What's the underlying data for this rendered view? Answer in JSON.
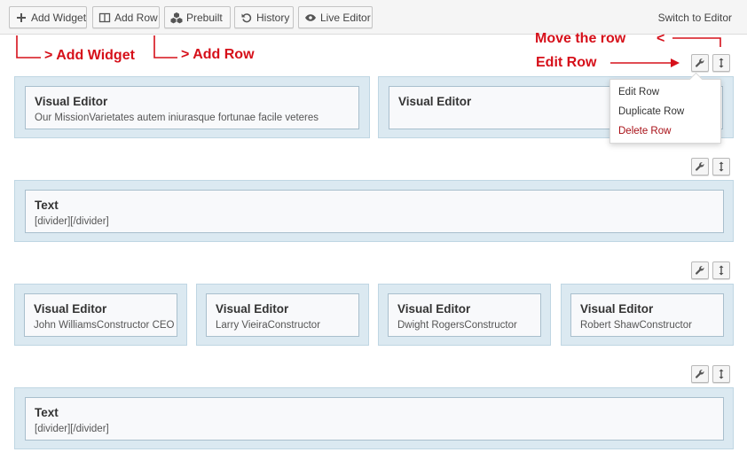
{
  "toolbar": {
    "add_widget": "Add Widget",
    "add_row": "Add Row",
    "prebuilt": "Prebuilt",
    "history": "History",
    "live_editor": "Live Editor",
    "switch_to_editor": "Switch to Editor"
  },
  "annotations": {
    "add_widget": "> Add Widget",
    "add_row": "> Add Row",
    "move_row": "Move the row",
    "move_arrow_head": "<",
    "edit_row": "Edit Row"
  },
  "rows": [
    {
      "cells": [
        {
          "title": "Visual Editor",
          "desc": "Our MissionVarietates autem iniurasque fortunae facile veteres"
        },
        {
          "title": "Visual Editor",
          "desc": ""
        }
      ]
    },
    {
      "cells": [
        {
          "title": "Text",
          "desc": "[divider][/divider]"
        }
      ]
    },
    {
      "cells": [
        {
          "title": "Visual Editor",
          "desc": "John WilliamsConstructor CEO"
        },
        {
          "title": "Visual Editor",
          "desc": "Larry VieiraConstructor"
        },
        {
          "title": "Visual Editor",
          "desc": "Dwight RogersConstructor"
        },
        {
          "title": "Visual Editor",
          "desc": "Robert ShawConstructor"
        }
      ]
    },
    {
      "cells": [
        {
          "title": "Text",
          "desc": "[divider][/divider]"
        }
      ]
    }
  ],
  "row_menu": {
    "edit_row": "Edit Row",
    "duplicate_row": "Duplicate Row",
    "delete_row": "Delete Row"
  },
  "colors": {
    "annotation_red": "#d6101a",
    "cell_bg": "#dbe9f1",
    "widget_border": "#a9bfcd",
    "delete_red": "#a80f16"
  }
}
